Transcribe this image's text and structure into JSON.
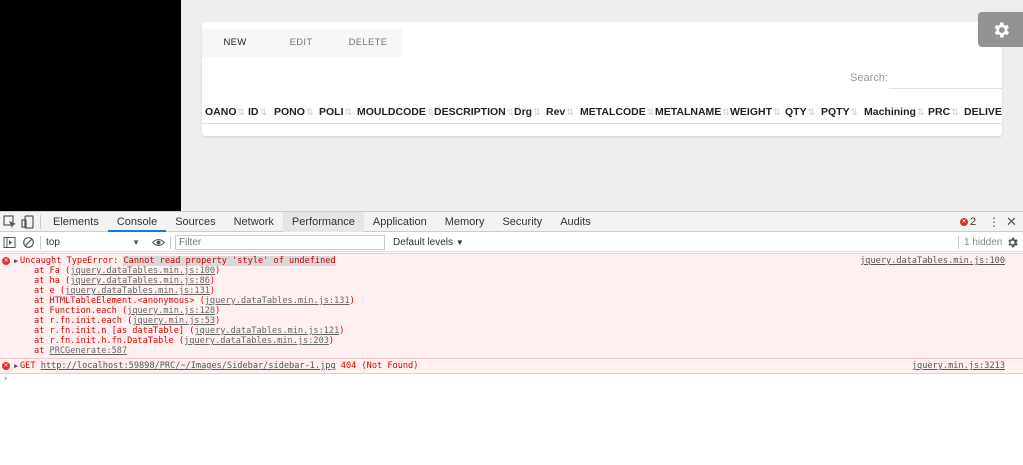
{
  "page": {
    "buttons": {
      "new": "NEW",
      "edit": "EDIT",
      "delete": "DELETE"
    },
    "search_label": "Search:",
    "columns": [
      "OANO",
      "ID",
      "PONO",
      "POLI",
      "MOULDCODE",
      "DESCRIPTION",
      "Drg",
      "Rev",
      "METALCODE",
      "METALNAME",
      "WEIGHT",
      "QTY",
      "PQTY",
      "Machining",
      "PRC",
      "DELIVERYDT"
    ],
    "sort_glyph": "⇅"
  },
  "devtools": {
    "tabs": [
      "Elements",
      "Console",
      "Sources",
      "Network",
      "Performance",
      "Application",
      "Memory",
      "Security",
      "Audits"
    ],
    "active_tab": "Console",
    "error_count": "2",
    "context": "top",
    "filter_placeholder": "Filter",
    "levels": "Default levels",
    "hidden": "1 hidden",
    "messages": [
      {
        "prefix": "Uncaught TypeError: ",
        "highlight": "Cannot read property 'style' of undefined",
        "source": "jquery.dataTables.min.js:100",
        "stack": [
          {
            "fn": "at Fa (",
            "link": "jquery.dataTables.min.js:100",
            "end": ")"
          },
          {
            "fn": "at ha (",
            "link": "jquery.dataTables.min.js:86",
            "end": ")"
          },
          {
            "fn": "at e (",
            "link": "jquery.dataTables.min.js:131",
            "end": ")"
          },
          {
            "fn": "at HTMLTableElement.<anonymous> (",
            "link": "jquery.dataTables.min.js:131",
            "end": ")"
          },
          {
            "fn": "at Function.each (",
            "link": "jquery.min.js:128",
            "end": ")"
          },
          {
            "fn": "at r.fn.init.each (",
            "link": "jquery.min.js:53",
            "end": ")"
          },
          {
            "fn": "at r.fn.init.n [as dataTable] (",
            "link": "jquery.dataTables.min.js:121",
            "end": ")"
          },
          {
            "fn": "at r.fn.init.h.fn.DataTable (",
            "link": "jquery.dataTables.min.js:203",
            "end": ")"
          },
          {
            "fn": "at ",
            "link": "PRCGenerate:587",
            "end": ""
          }
        ]
      },
      {
        "method": "GET ",
        "url": "http://localhost:59898/PRC/~/Images/Sidebar/sidebar-1.jpg",
        "status": " 404 (Not Found)",
        "source": "jquery.min.js:3213"
      }
    ]
  }
}
